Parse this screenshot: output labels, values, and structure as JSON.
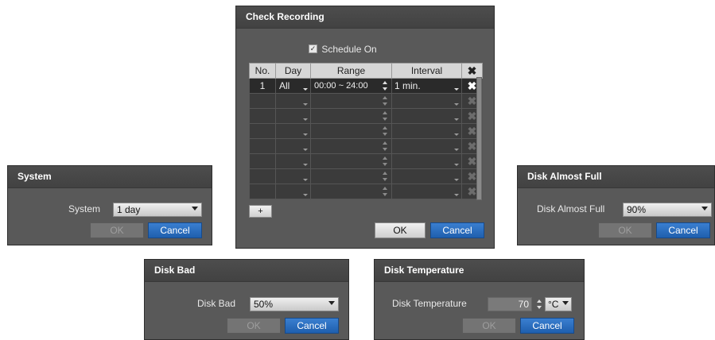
{
  "check_recording": {
    "title": "Check Recording",
    "schedule_on_label": "Schedule On",
    "schedule_on_checked": true,
    "columns": {
      "no": "No.",
      "day": "Day",
      "range": "Range",
      "interval": "Interval"
    },
    "rows": [
      {
        "no": "1",
        "day": "All",
        "range": "00:00 ~ 24:00",
        "interval": "1 min."
      },
      {
        "no": "",
        "day": "",
        "range": "",
        "interval": ""
      },
      {
        "no": "",
        "day": "",
        "range": "",
        "interval": ""
      },
      {
        "no": "",
        "day": "",
        "range": "",
        "interval": ""
      },
      {
        "no": "",
        "day": "",
        "range": "",
        "interval": ""
      },
      {
        "no": "",
        "day": "",
        "range": "",
        "interval": ""
      },
      {
        "no": "",
        "day": "",
        "range": "",
        "interval": ""
      },
      {
        "no": "",
        "day": "",
        "range": "",
        "interval": ""
      }
    ],
    "add_label": "+",
    "ok_label": "OK",
    "cancel_label": "Cancel"
  },
  "system": {
    "title": "System",
    "field_label": "System",
    "value": "1 day",
    "ok_label": "OK",
    "cancel_label": "Cancel"
  },
  "disk_almost_full": {
    "title": "Disk Almost Full",
    "field_label": "Disk Almost Full",
    "value": "90%",
    "ok_label": "OK",
    "cancel_label": "Cancel"
  },
  "disk_bad": {
    "title": "Disk Bad",
    "field_label": "Disk Bad",
    "value": "50%",
    "ok_label": "OK",
    "cancel_label": "Cancel"
  },
  "disk_temperature": {
    "title": "Disk Temperature",
    "field_label": "Disk Temperature",
    "value": "70",
    "unit": "°C",
    "ok_label": "OK",
    "cancel_label": "Cancel"
  },
  "colors": {
    "dialog_bg": "#595959",
    "titlebar_bg": "#444444",
    "accent_button": "#2a6cc0",
    "table_header": "#d6d6d6",
    "table_cell": "#3b3b3b"
  }
}
